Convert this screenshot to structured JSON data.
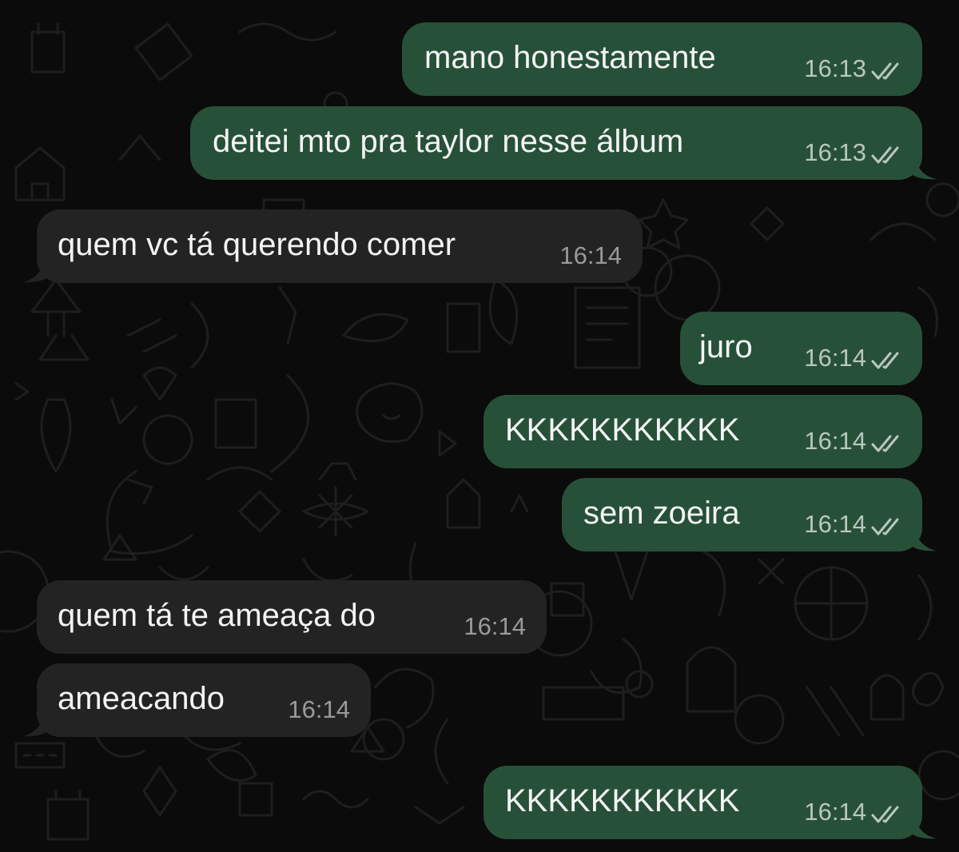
{
  "colors": {
    "background": "#0b0b0b",
    "outgoing_bubble": "#275038",
    "incoming_bubble": "#232323",
    "message_text": "#f4f4f4",
    "outgoing_meta": "#b9c7bf",
    "incoming_meta": "#9a9a9a"
  },
  "messages": [
    {
      "text": "mano honestamente",
      "time": "16:13",
      "direction": "outgoing",
      "status": "double-check-icon"
    },
    {
      "text": "deitei mto pra taylor nesse álbum",
      "time": "16:13",
      "direction": "outgoing",
      "status": "double-check-icon"
    },
    {
      "text": "quem vc tá querendo comer",
      "time": "16:14",
      "direction": "incoming"
    },
    {
      "text": "juro",
      "time": "16:14",
      "direction": "outgoing",
      "status": "double-check-icon"
    },
    {
      "text": "KKKKKKKKKKK",
      "time": "16:14",
      "direction": "outgoing",
      "status": "double-check-icon"
    },
    {
      "text": "sem zoeira",
      "time": "16:14",
      "direction": "outgoing",
      "status": "double-check-icon"
    },
    {
      "text": "quem tá te ameaça do",
      "time": "16:14",
      "direction": "incoming"
    },
    {
      "text": "ameacando",
      "time": "16:14",
      "direction": "incoming"
    },
    {
      "text": "KKKKKKKKKKK",
      "time": "16:14",
      "direction": "outgoing",
      "status": "double-check-icon"
    }
  ]
}
